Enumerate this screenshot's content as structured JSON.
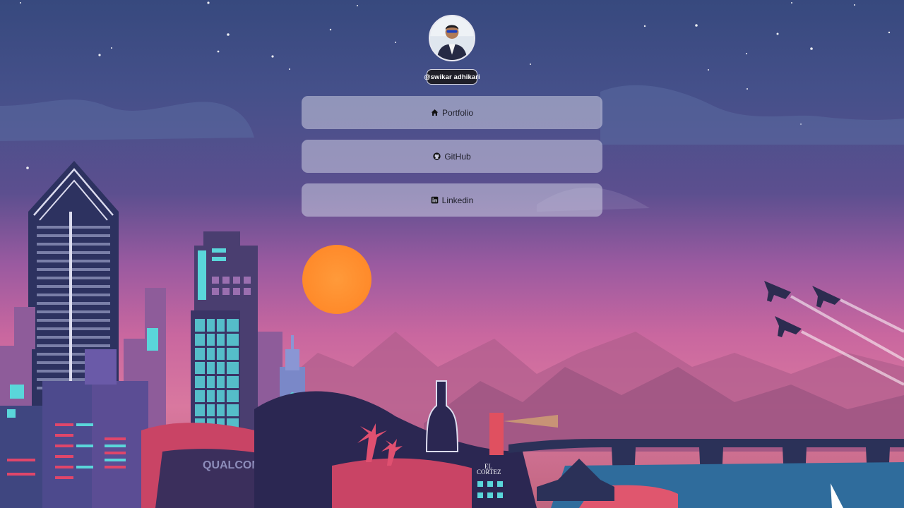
{
  "profile": {
    "handle": "@swikar adhikari"
  },
  "links": [
    {
      "label": "Portfolio",
      "icon": "home-icon"
    },
    {
      "label": "GitHub",
      "icon": "github-icon"
    },
    {
      "label": "Linkedin",
      "icon": "linkedin-icon"
    }
  ],
  "scene": {
    "signs": {
      "qualcomm": "QUALCOMM",
      "el": "EL",
      "cortez": "CORTEZ"
    }
  },
  "colors": {
    "link_bg": "rgba(205,205,225,0.55)",
    "handle_bg": "#1f1f28",
    "sun": "#ff9a3a"
  }
}
